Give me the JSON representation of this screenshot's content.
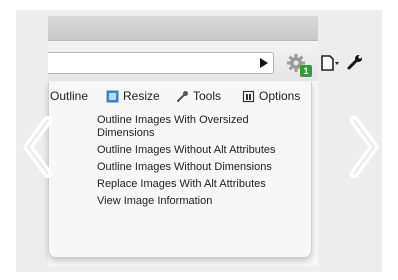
{
  "header": {
    "top_link_text": ""
  },
  "toolbar": {
    "go_icon": "play-triangle-icon",
    "extension_icon": "gear-icon",
    "extension_badge": "1",
    "page_menu_icon": "page-icon",
    "wrench_menu_icon": "wrench-icon"
  },
  "menu": {
    "tabs": [
      {
        "label": "Outline",
        "icon": ""
      },
      {
        "label": "Resize",
        "icon": "resize-icon"
      },
      {
        "label": "Tools",
        "icon": "wrench-icon"
      },
      {
        "label": "Options",
        "icon": "options-icon"
      }
    ],
    "items": [
      {
        "label": "Outline Images With Oversized Dimensions"
      },
      {
        "label": "Outline Images Without Alt Attributes"
      },
      {
        "label": "Outline Images Without Dimensions"
      },
      {
        "label": "Replace Images With Alt Attributes"
      },
      {
        "label": "View Image Information"
      }
    ]
  },
  "carousel": {
    "prev_icon": "chevron-left-icon",
    "next_icon": "chevron-right-icon"
  },
  "colors": {
    "badge": "#2e9e3a",
    "link": "#3a66c4",
    "stage": "#ededed"
  }
}
